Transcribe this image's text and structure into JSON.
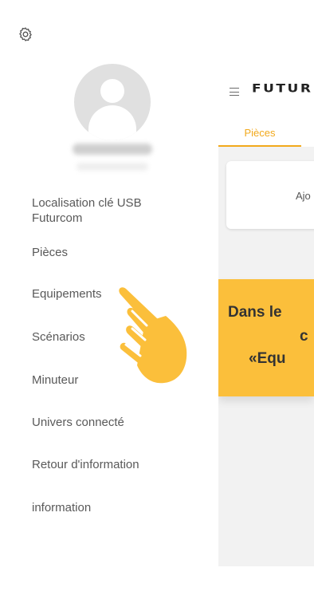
{
  "app": {
    "brand": "FUTUR",
    "tab_active": "Pièces",
    "card_text": "Ajo",
    "banner_lines": [
      "Dans le",
      "c",
      "«Equ"
    ]
  },
  "drawer": {
    "settings_icon": "gear-icon",
    "avatar_icon": "user-avatar-icon",
    "menu": [
      {
        "label": "Localisation clé USB",
        "label2": "Futurcom"
      },
      {
        "label": "Pièces"
      },
      {
        "label": "Equipements"
      },
      {
        "label": "Scénarios"
      },
      {
        "label": "Minuteur"
      },
      {
        "label": "Univers connecté"
      },
      {
        "label": "Retour d'information"
      },
      {
        "label": "information"
      }
    ]
  },
  "overlay": {
    "icon": "pointing-hand-icon"
  },
  "colors": {
    "accent": "#f2a91c",
    "banner": "#fbbf3b",
    "hand": "#fbbf3b"
  }
}
